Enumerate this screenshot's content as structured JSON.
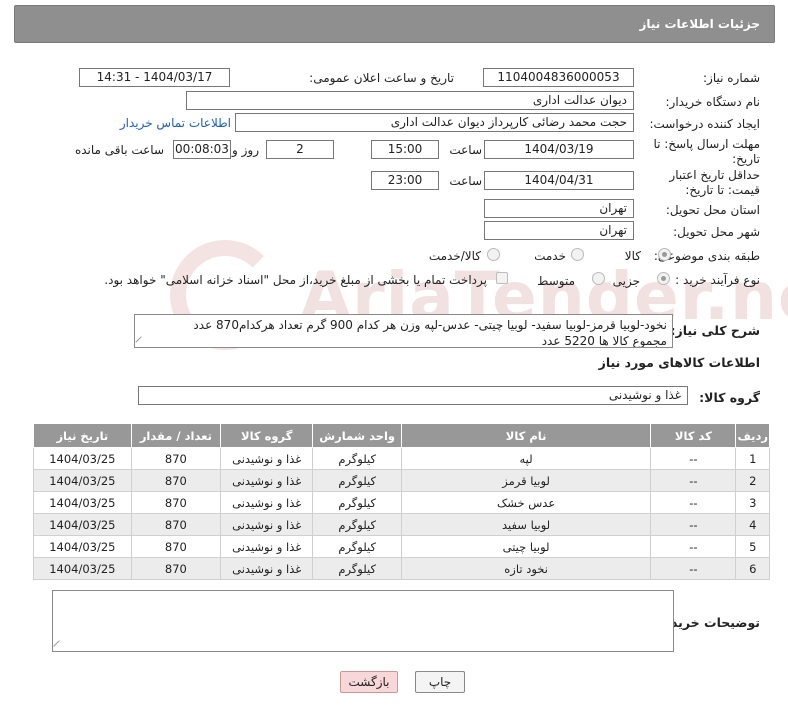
{
  "header": {
    "title": "جزئیات اطلاعات نیاز"
  },
  "need_number": {
    "label": "شماره نیاز:",
    "value": "1104004836000053"
  },
  "announce": {
    "label": "تاریخ و ساعت اعلان عمومی:",
    "value": "1404/03/17 - 14:31"
  },
  "buyer_org": {
    "label": "نام دستگاه خریدار:",
    "value": "دیوان عدالت اداری"
  },
  "requester": {
    "label": "ایجاد کننده درخواست:",
    "value": "حجت محمد رضائی کارپرداز دیوان عدالت اداری",
    "contact_link": "اطلاعات تماس خریدار"
  },
  "deadline": {
    "label": "مهلت ارسال پاسخ: تا تاریخ:",
    "date": "1404/03/19",
    "time_label": "ساعت",
    "time": "15:00",
    "days": "2",
    "days_label": "روز و",
    "remaining": "00:08:03",
    "remaining_label": "ساعت باقی مانده"
  },
  "price_validity": {
    "label": "حداقل تاریخ اعتبار قیمت: تا تاریخ:",
    "date": "1404/04/31",
    "time_label": "ساعت",
    "time": "23:00"
  },
  "province": {
    "label": "استان محل تحویل:",
    "value": "تهران"
  },
  "city": {
    "label": "شهر محل تحویل:",
    "value": "تهران"
  },
  "category": {
    "label": "طبقه بندی موضوعی:",
    "options": [
      "کالا",
      "خدمت",
      "کالا/خدمت"
    ],
    "selected": "کالا"
  },
  "process": {
    "label": "نوع فرآیند خرید :",
    "options": [
      "جزیی",
      "متوسط"
    ],
    "selected": "جزیی",
    "payment_note": "پرداخت تمام یا بخشی از مبلغ خرید،از محل \"اسناد خزانه اسلامی\" خواهد بود."
  },
  "description": {
    "label": "شرح کلی نیاز:",
    "line1": "نخود-لوبیا قرمز-لوبیا سفید- لوبیا چیتی- عدس-لپه وزن هر کدام 900 گرم تعداد هرکدام870 عدد",
    "line2": "مجموع کالا ها 5220 عدد"
  },
  "items_section": {
    "title": "اطلاعات کالاهای مورد نیاز"
  },
  "goods_group": {
    "label": "گروه کالا:",
    "value": "غذا و نوشیدنی"
  },
  "table": {
    "headers": [
      "ردیف",
      "کد کالا",
      "نام کالا",
      "واحد شمارش",
      "گروه کالا",
      "تعداد / مقدار",
      "تاریخ نیاز"
    ],
    "rows": [
      [
        "1",
        "--",
        "لپه",
        "کیلوگرم",
        "غذا و نوشیدنی",
        "870",
        "1404/03/25"
      ],
      [
        "2",
        "--",
        "لوبیا قرمز",
        "کیلوگرم",
        "غذا و نوشیدنی",
        "870",
        "1404/03/25"
      ],
      [
        "3",
        "--",
        "عدس خشک",
        "کیلوگرم",
        "غذا و نوشیدنی",
        "870",
        "1404/03/25"
      ],
      [
        "4",
        "--",
        "لوبیا سفید",
        "کیلوگرم",
        "غذا و نوشیدنی",
        "870",
        "1404/03/25"
      ],
      [
        "5",
        "--",
        "لوبیا چیتی",
        "کیلوگرم",
        "غذا و نوشیدنی",
        "870",
        "1404/03/25"
      ],
      [
        "6",
        "--",
        "نخود تازه",
        "کیلوگرم",
        "غذا و نوشیدنی",
        "870",
        "1404/03/25"
      ]
    ]
  },
  "buyer_notes": {
    "label": "توضیحات خریدار:",
    "value": ""
  },
  "buttons": {
    "print": "چاپ",
    "back": "بازگشت"
  },
  "watermark": {
    "text": "AriaTender.net"
  }
}
